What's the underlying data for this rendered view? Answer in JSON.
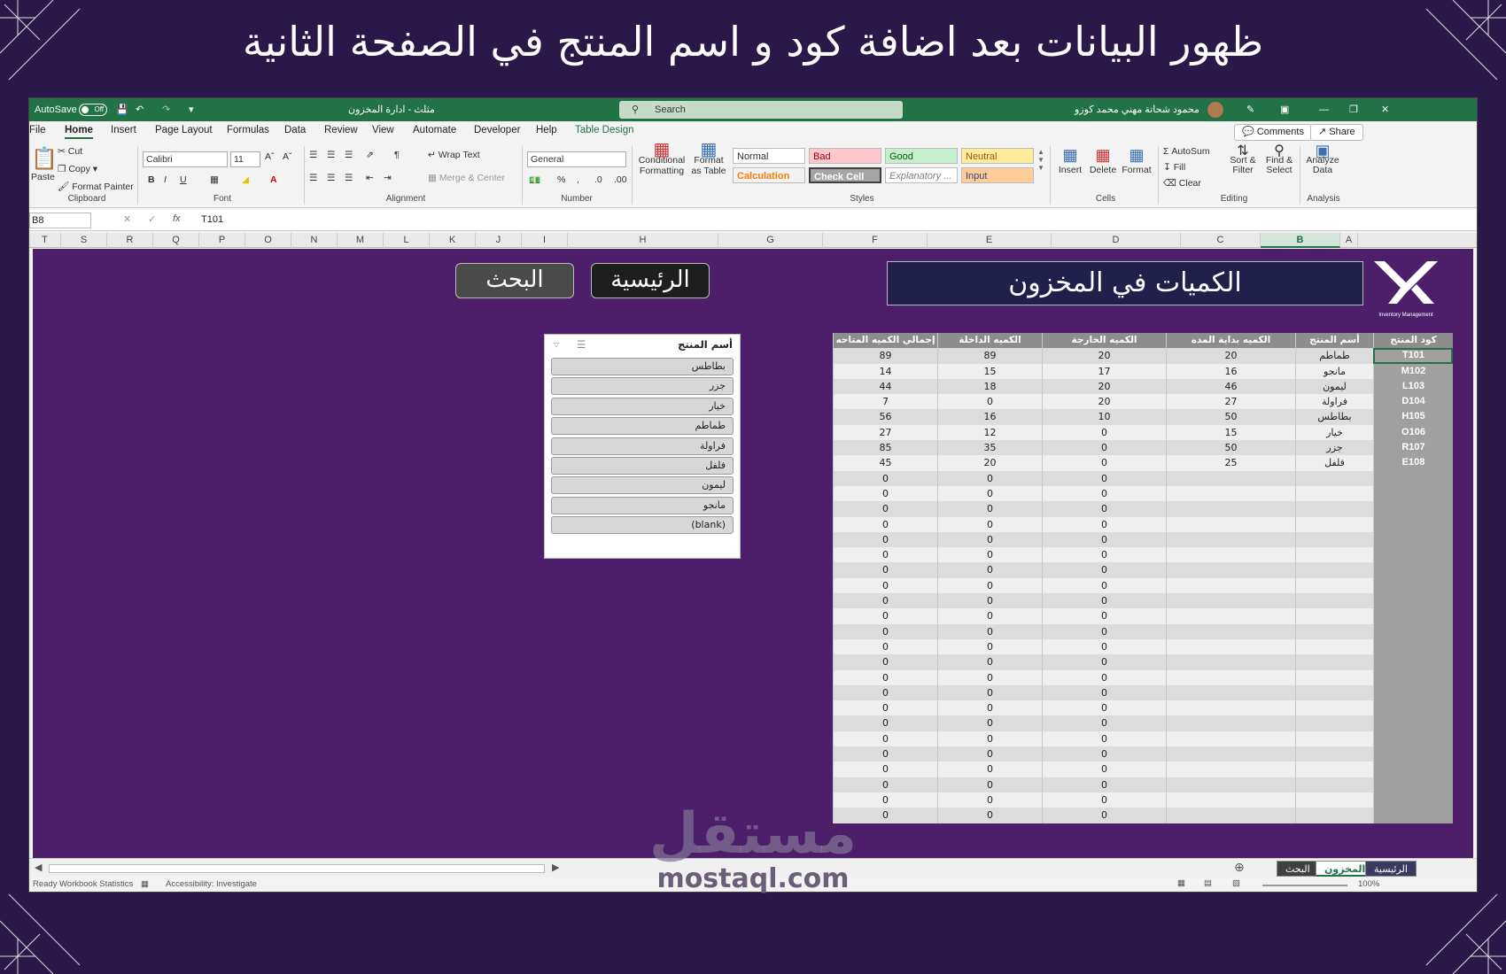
{
  "banner": {
    "title": "ظهور البيانات بعد اضافة كود و اسم المنتج في الصفحة الثانية"
  },
  "titlebar": {
    "autosave": "AutoSave",
    "autosave_state": "Off",
    "file_name": "مثلث - ادارة المخزون",
    "search_placeholder": "Search",
    "user_name": "محمود شحاتة مهني محمد كوزو"
  },
  "menu": {
    "tabs": [
      "File",
      "Home",
      "Insert",
      "Page Layout",
      "Formulas",
      "Data",
      "Review",
      "View",
      "Automate",
      "Developer",
      "Help",
      "Table Design"
    ],
    "comments": "Comments",
    "share": "Share"
  },
  "ribbon": {
    "clipboard": {
      "paste": "Paste",
      "cut": "Cut",
      "copy": "Copy",
      "format_painter": "Format Painter",
      "label": "Clipboard"
    },
    "font": {
      "family": "Calibri",
      "size": "11",
      "label": "Font"
    },
    "alignment": {
      "wrap": "Wrap Text",
      "merge": "Merge & Center",
      "label": "Alignment"
    },
    "number": {
      "format": "General",
      "label": "Number"
    },
    "styles": {
      "conditional": "Conditional Formatting",
      "format_table": "Format as Table",
      "normal": "Normal",
      "bad": "Bad",
      "good": "Good",
      "neutral": "Neutral",
      "calculation": "Calculation",
      "check_cell": "Check Cell",
      "explanatory": "Explanatory ...",
      "input": "Input",
      "label": "Styles"
    },
    "cells": {
      "insert": "Insert",
      "delete": "Delete",
      "format": "Format",
      "label": "Cells"
    },
    "editing": {
      "autosum": "AutoSum",
      "fill": "Fill",
      "clear": "Clear",
      "sort": "Sort & Filter",
      "find": "Find & Select",
      "label": "Editing"
    },
    "analysis": {
      "analyze": "Analyze Data",
      "label": "Analysis"
    }
  },
  "formula_bar": {
    "name_box": "B8",
    "fx": "fx",
    "value": "T101"
  },
  "columns": [
    "T",
    "S",
    "R",
    "Q",
    "P",
    "O",
    "N",
    "M",
    "L",
    "K",
    "J",
    "I",
    "H",
    "G",
    "F",
    "E",
    "D",
    "C",
    "B",
    "A"
  ],
  "sheet": {
    "title": "الكميات في المخزون",
    "logo_caption": "Inventory Management",
    "search_btn": "البحث",
    "home_btn": "الرئيسية"
  },
  "table": {
    "headers": [
      "كود المنتج",
      "أسم المنتج",
      "الكميه بداية المده",
      "الكميه الخارجة",
      "الكميه الداخلة",
      "إجمالي الكميه المتاحه"
    ],
    "rows": [
      [
        "T101",
        "طماطم",
        "20",
        "20",
        "89",
        "89"
      ],
      [
        "M102",
        "مانجو",
        "16",
        "17",
        "15",
        "14"
      ],
      [
        "L103",
        "ليمون",
        "46",
        "20",
        "18",
        "44"
      ],
      [
        "D104",
        "فراولة",
        "27",
        "20",
        "0",
        "7"
      ],
      [
        "H105",
        "بطاطس",
        "50",
        "10",
        "16",
        "56"
      ],
      [
        "O106",
        "خيار",
        "15",
        "0",
        "12",
        "27"
      ],
      [
        "R107",
        "جزر",
        "50",
        "0",
        "35",
        "85"
      ],
      [
        "E108",
        "فلفل",
        "25",
        "0",
        "20",
        "45"
      ],
      [
        "",
        "",
        "",
        "0",
        "0",
        "0"
      ],
      [
        "",
        "",
        "",
        "0",
        "0",
        "0"
      ],
      [
        "",
        "",
        "",
        "0",
        "0",
        "0"
      ],
      [
        "",
        "",
        "",
        "0",
        "0",
        "0"
      ],
      [
        "",
        "",
        "",
        "0",
        "0",
        "0"
      ],
      [
        "",
        "",
        "",
        "0",
        "0",
        "0"
      ],
      [
        "",
        "",
        "",
        "0",
        "0",
        "0"
      ],
      [
        "",
        "",
        "",
        "0",
        "0",
        "0"
      ],
      [
        "",
        "",
        "",
        "0",
        "0",
        "0"
      ],
      [
        "",
        "",
        "",
        "0",
        "0",
        "0"
      ],
      [
        "",
        "",
        "",
        "0",
        "0",
        "0"
      ],
      [
        "",
        "",
        "",
        "0",
        "0",
        "0"
      ],
      [
        "",
        "",
        "",
        "0",
        "0",
        "0"
      ],
      [
        "",
        "",
        "",
        "0",
        "0",
        "0"
      ],
      [
        "",
        "",
        "",
        "0",
        "0",
        "0"
      ],
      [
        "",
        "",
        "",
        "0",
        "0",
        "0"
      ],
      [
        "",
        "",
        "",
        "0",
        "0",
        "0"
      ],
      [
        "",
        "",
        "",
        "0",
        "0",
        "0"
      ],
      [
        "",
        "",
        "",
        "0",
        "0",
        "0"
      ],
      [
        "",
        "",
        "",
        "0",
        "0",
        "0"
      ],
      [
        "",
        "",
        "",
        "0",
        "0",
        "0"
      ],
      [
        "",
        "",
        "",
        "0",
        "0",
        "0"
      ],
      [
        "",
        "",
        "",
        "0",
        "0",
        "0"
      ]
    ]
  },
  "slicer": {
    "title": "أسم المنتج",
    "items": [
      "بطاطس",
      "جزر",
      "خيار",
      "طماطم",
      "فراولة",
      "فلفل",
      "ليمون",
      "مانجو",
      "(blank)"
    ]
  },
  "sheet_tabs": [
    "الرئيسية",
    "المخزون",
    "البحث"
  ],
  "status": {
    "ready": "Ready",
    "stats": "Workbook Statistics",
    "access": "Accessibility: Investigate",
    "zoom": "100%"
  },
  "watermark": {
    "arabic": "مستقل",
    "latin": "mostaql.com"
  },
  "colors": {
    "excel_green": "#217346",
    "sheet_purple": "#4d1f6b",
    "title_navy": "#20204a"
  }
}
